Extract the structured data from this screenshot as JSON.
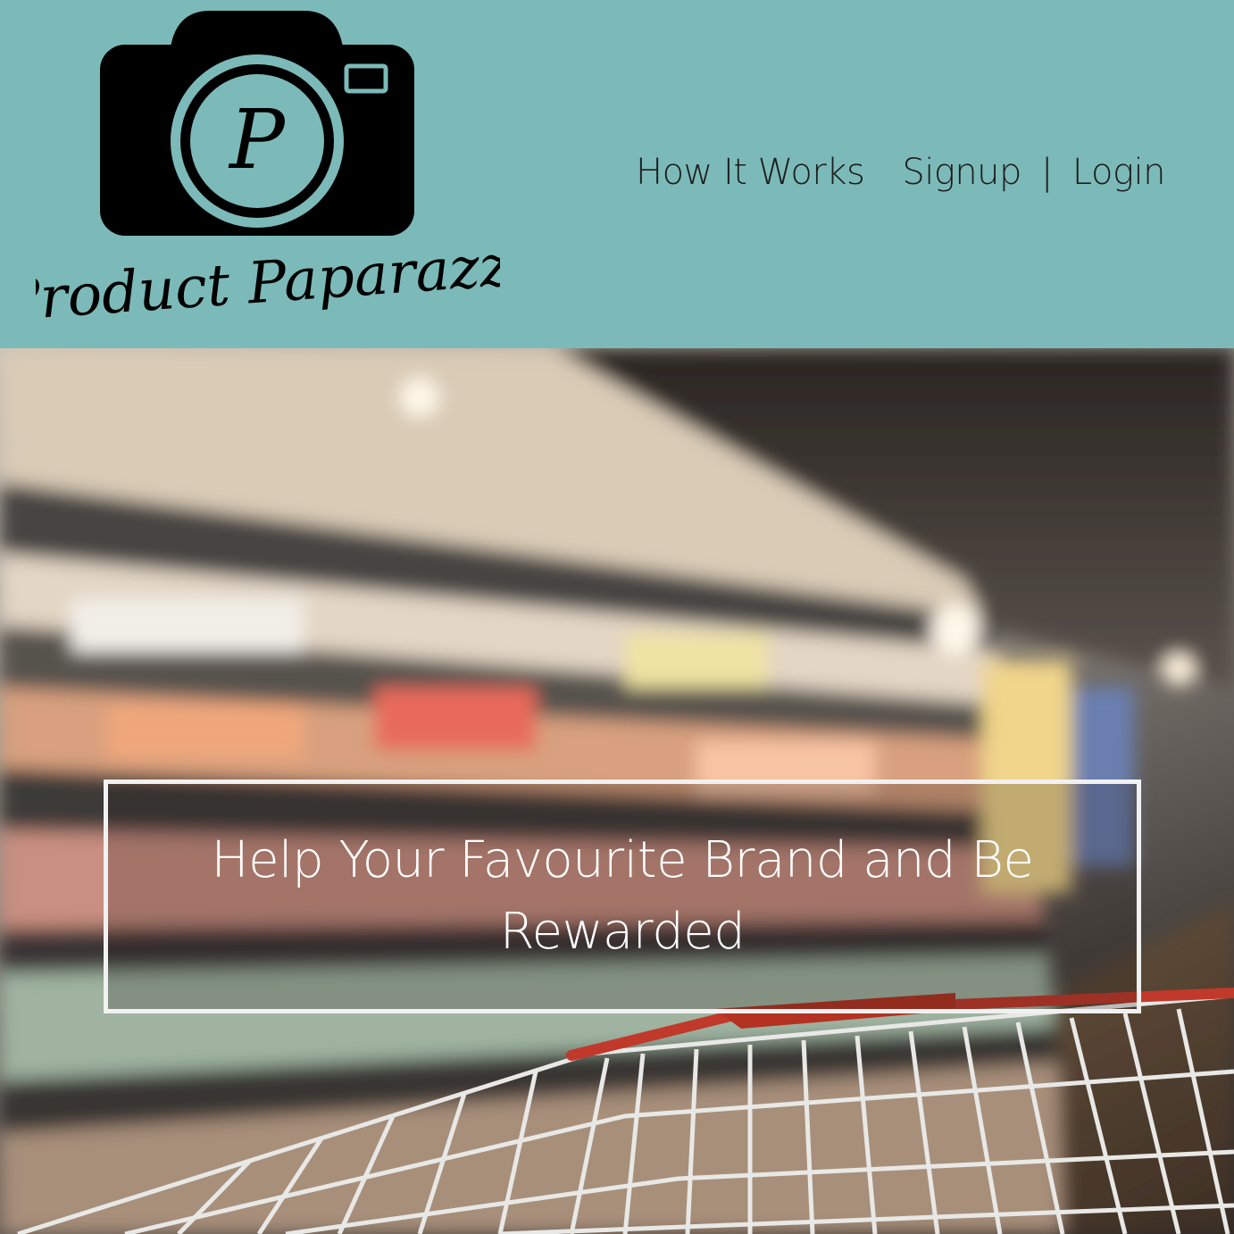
{
  "brand": {
    "name": "Product Paparazzi",
    "monogram": "P",
    "logo_icon": "camera-icon"
  },
  "nav": {
    "how_it_works": "How It Works",
    "signup": "Signup",
    "separator": "|",
    "login": "Login"
  },
  "hero": {
    "headline": "Help Your Favourite Brand and Be Rewarded",
    "background_subject": "supermarket aisle with shopping cart"
  },
  "colors": {
    "header_bg": "#7bbab8",
    "nav_text": "#1d1d1d",
    "headline_text": "#ffffff",
    "cart_handle": "#c0392b"
  }
}
